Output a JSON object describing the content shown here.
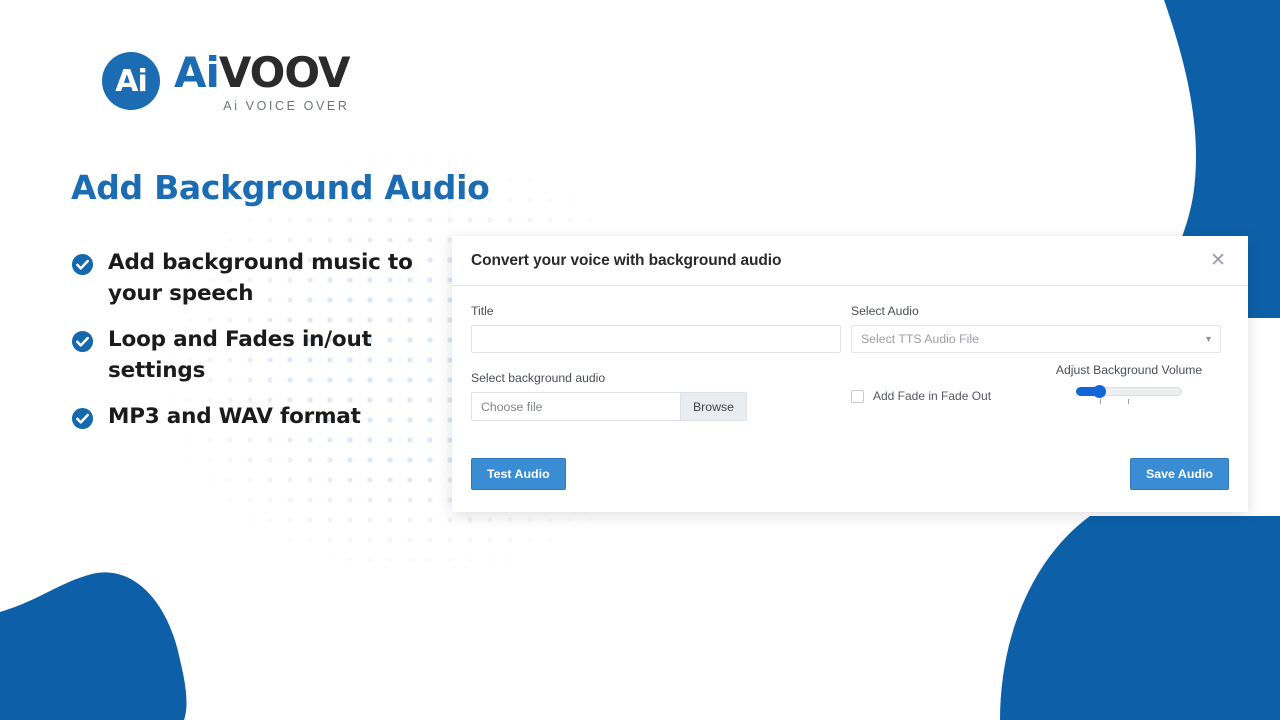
{
  "brand": {
    "mark_text": "Ai",
    "name_first": "Ai",
    "name_second": "VOOV",
    "tagline": "Ai VOICE OVER",
    "primary_color": "#0d60a8",
    "heading_color": "#1b6cb2",
    "button_color": "#3a8dd2",
    "slider_color": "#1266d8"
  },
  "headline": "Add Background Audio",
  "features": [
    {
      "icon": "check-circle-icon",
      "text": "Add background music to your speech"
    },
    {
      "icon": "check-circle-icon",
      "text": "Loop and Fades in/out settings"
    },
    {
      "icon": "check-circle-icon",
      "text": "MP3 and WAV format"
    }
  ],
  "modal": {
    "title": "Convert your voice with background audio",
    "close_icon": "close-icon",
    "fields": {
      "title_label": "Title",
      "title_value": "",
      "title_placeholder": "",
      "select_audio_label": "Select Audio",
      "select_audio_value": "Select TTS Audio File",
      "select_audio_chevron": "chevron-down-icon",
      "background_audio_label": "Select background audio",
      "file_placeholder": "Choose file",
      "browse_label": "Browse",
      "fade_label": "Add Fade in Fade Out",
      "fade_checked": false,
      "volume_label": "Adjust Background Volume",
      "volume_value": 20
    },
    "buttons": {
      "test": "Test Audio",
      "save": "Save Audio"
    }
  }
}
